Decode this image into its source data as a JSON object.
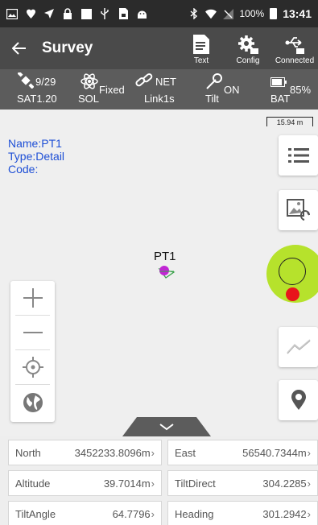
{
  "statusbar": {
    "battery_percent": "100%",
    "time": "13:41"
  },
  "toolbar": {
    "title": "Survey",
    "actions": [
      {
        "label": "Text"
      },
      {
        "label": "Config"
      },
      {
        "label": "Connected"
      }
    ]
  },
  "infobar": {
    "sat": {
      "top": "9/29",
      "bottom": "SAT1.20"
    },
    "sol": {
      "top": "Fixed",
      "bottom": "SOL"
    },
    "net": {
      "top": "NET",
      "bottom": "Link1s"
    },
    "tilt": {
      "top": "ON",
      "bottom": "Tilt"
    },
    "bat": {
      "top": "85%",
      "bottom": "BAT"
    }
  },
  "map": {
    "scale_label": "15.94 m",
    "point_name": "Name:PT1",
    "point_type": "Type:Detail",
    "point_code": "Code:",
    "point_label": "PT1"
  },
  "data": [
    {
      "left": {
        "label": "North",
        "value": "3452233.8096m"
      },
      "right": {
        "label": "East",
        "value": "56540.7344m"
      }
    },
    {
      "left": {
        "label": "Altitude",
        "value": "39.7014m"
      },
      "right": {
        "label": "TiltDirect",
        "value": "304.2285"
      }
    },
    {
      "left": {
        "label": "TiltAngle",
        "value": "64.7796"
      },
      "right": {
        "label": "Heading",
        "value": "301.2942"
      }
    }
  ],
  "chevron": "›",
  "colors": {
    "toolbar_bg": "#4a4a4a",
    "infobar_bg": "#5c5c5c",
    "point_info_text": "#1e4fd6",
    "target_fill": "#b6e22c",
    "target_dot": "#e8141b"
  }
}
